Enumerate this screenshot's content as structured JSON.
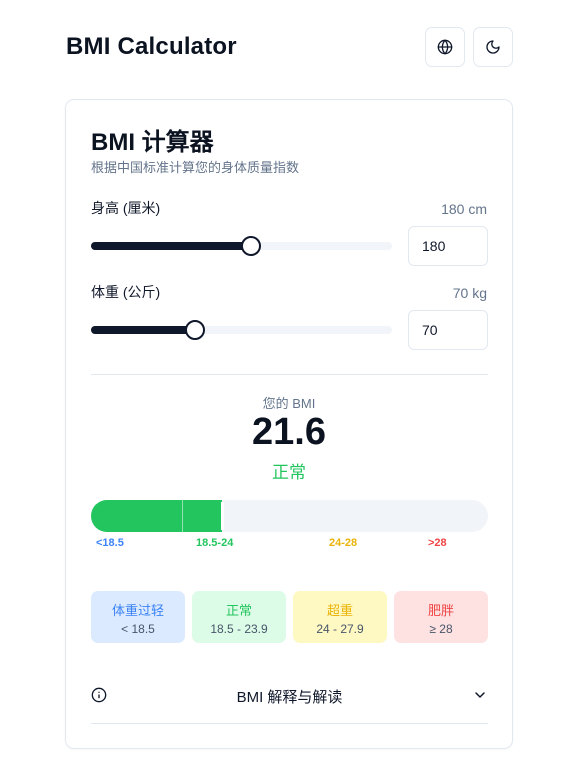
{
  "header": {
    "title": "BMI Calculator",
    "language_icon": "globe-icon",
    "theme_icon": "moon-icon"
  },
  "card": {
    "title": "BMI 计算器",
    "subtitle": "根据中国标准计算您的身体质量指数",
    "height": {
      "label": "身高 (厘米)",
      "display": "180 cm",
      "value": "180",
      "slider_fraction": 0.53
    },
    "weight": {
      "label": "体重 (公斤)",
      "display": "70 kg",
      "value": "70",
      "slider_fraction": 0.345
    },
    "result": {
      "label": "您的 BMI",
      "value": "21.6",
      "status": "正常",
      "status_color": "#22c55e"
    },
    "scale": {
      "fill_fraction": 0.33,
      "ticks": [
        {
          "label": "<18.5",
          "color": "#3b82f6"
        },
        {
          "label": "18.5-24",
          "color": "#22c55e"
        },
        {
          "label": "24-28",
          "color": "#eab308"
        },
        {
          "label": ">28",
          "color": "#ef4444"
        }
      ]
    },
    "categories": [
      {
        "name": "体重过轻",
        "range": "< 18.5",
        "bg": "#dbeafe",
        "color": "#3b82f6"
      },
      {
        "name": "正常",
        "range": "18.5 - 23.9",
        "bg": "#dcfce7",
        "color": "#22c55e"
      },
      {
        "name": "超重",
        "range": "24 - 27.9",
        "bg": "#fef9c3",
        "color": "#eab308"
      },
      {
        "name": "肥胖",
        "range": "≥ 28",
        "bg": "#fee2e2",
        "color": "#ef4444"
      }
    ],
    "accordion": {
      "label": "BMI 解释与解读",
      "info_icon": "info-icon",
      "chevron_icon": "chevron-down-icon"
    }
  }
}
